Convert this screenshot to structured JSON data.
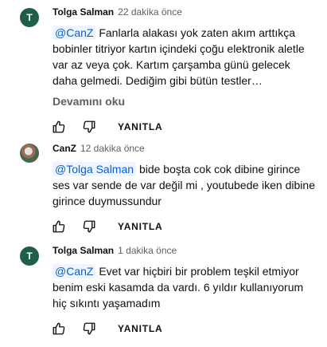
{
  "comments": [
    {
      "author": "Tolga Salman",
      "time": "22 dakika önce",
      "avatar_letter": "T",
      "mention": "@CanZ",
      "text": "Fanlarla alakası yok zaten akım arttıkça bobinler titriyor kartın içindeki çoğu elektronik aletle var az veya çok. Kartım çarşamba günü gelecek daha gelmedi. Dediğim gibi bütün testler…",
      "more_label": "Devamını oku",
      "reply_label": "YANITLA"
    },
    {
      "author": "CanZ",
      "time": "12 dakika önce",
      "mention": "@Tolga Salman",
      "text": "bide boşta cok cok dibine girince ses var sende de var değil mi , youtubede iken dibine girince duymussundur",
      "reply_label": "YANITLA"
    },
    {
      "author": "Tolga Salman",
      "time": "1 dakika önce",
      "avatar_letter": "T",
      "mention": "@CanZ",
      "text": "Evet var hiçbiri bir problem teşkil etmiyor benim eski kasamda da vardı. 6 yıldır kullanıyorum hiç sıkıntı yaşamadım",
      "reply_label": "YANITLA"
    }
  ],
  "colors": {
    "avatar_bg": "#1f5e49",
    "mention_text": "#065fd4",
    "mention_bg": "#eef5fe",
    "secondary_text": "#606060"
  },
  "icons": [
    "like-icon",
    "dislike-icon"
  ]
}
